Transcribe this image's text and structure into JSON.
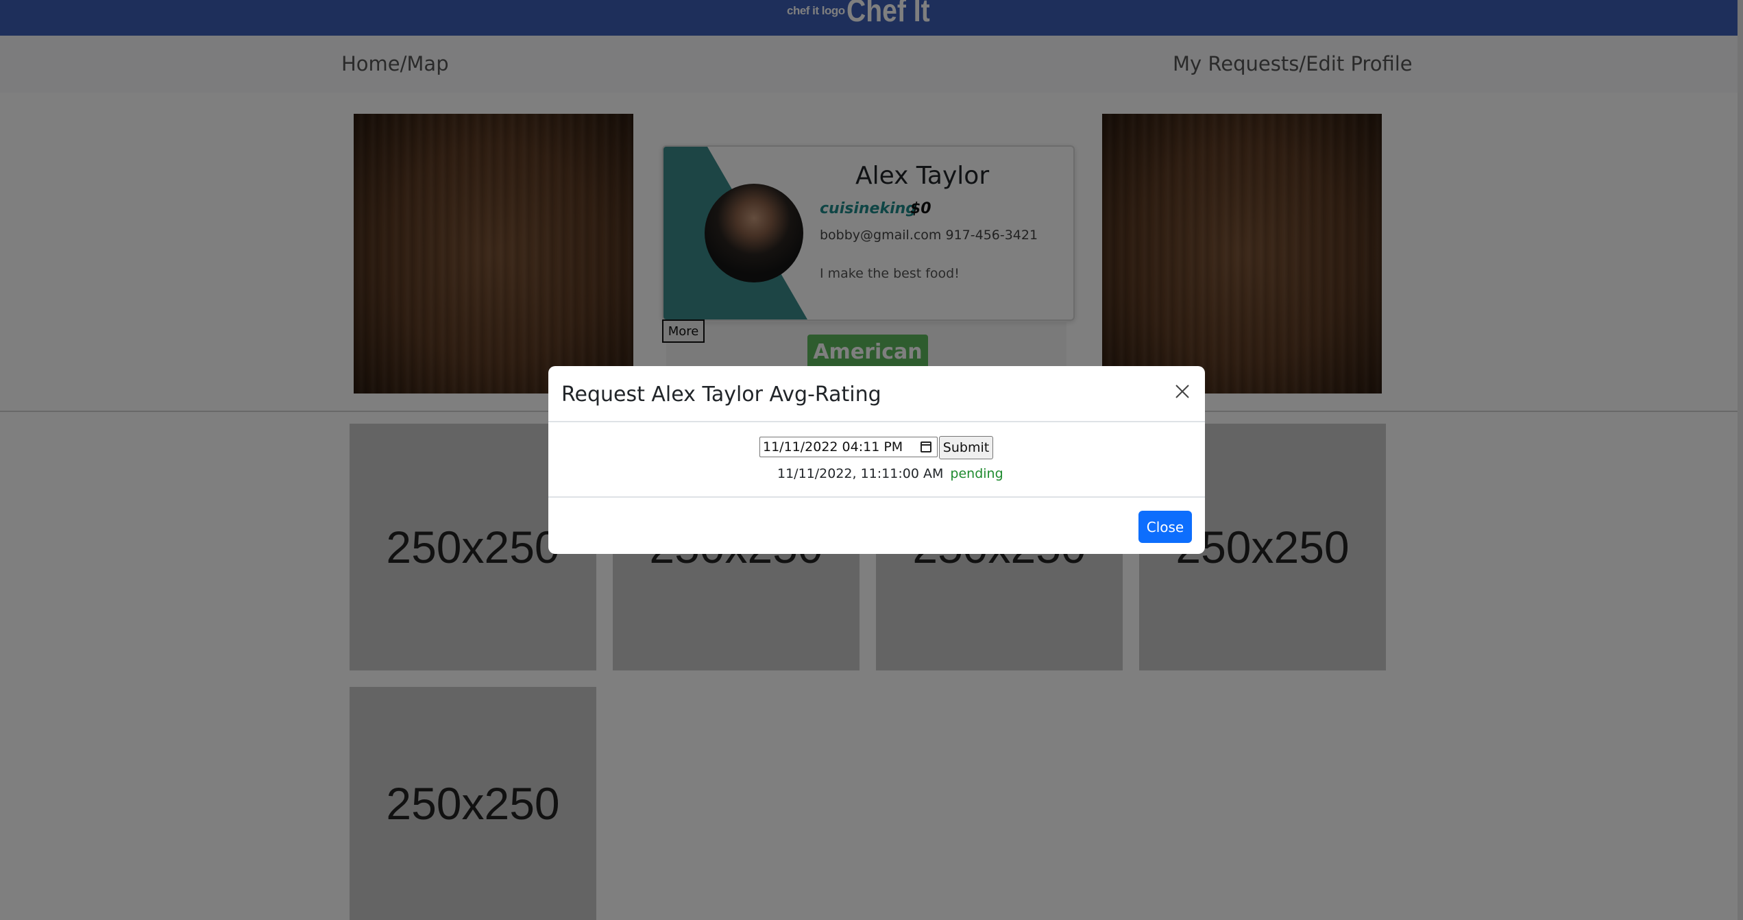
{
  "header": {
    "logo_alt": "chef it logo",
    "title": "Chef It",
    "bar_color": "#3c5fb7"
  },
  "nav": {
    "home_label": "Home/Map",
    "requests_label": "My Requests/Edit Profile"
  },
  "chef_card": {
    "name": "Alex Taylor",
    "username": "cuisineking",
    "price": "$0",
    "contact": "bobby@gmail.com 917-456-3421",
    "bio": "I make the best food!",
    "more_label": "More",
    "cuisine": "American",
    "accent_color": "#3a8a8a"
  },
  "gallery": {
    "placeholders": [
      "250x250",
      "250x250",
      "250x250",
      "250x250",
      "250x250"
    ]
  },
  "modal": {
    "title": "Request Alex Taylor Avg-Rating",
    "datetime_value": "11/11/2022 04:11 PM",
    "submit_label": "Submit",
    "request_time": "11/11/2022, 11:11:00 AM",
    "request_status": "pending",
    "close_label": "Close",
    "close_icon": "close-icon",
    "primary_color": "#0d6efd"
  }
}
